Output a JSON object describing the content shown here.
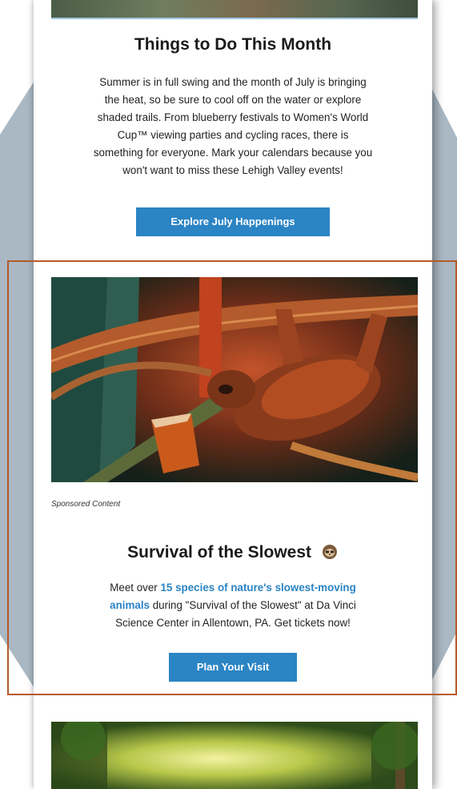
{
  "section1": {
    "title": "Things to Do This Month",
    "body_lines": [
      "Summer is in full swing and the month of July is bringing",
      "the heat, so be sure to cool off on the water or explore",
      "shaded trails. From blueberry festivals to Women's World",
      "Cup™ viewing parties and cycling races, there is",
      "something for everyone. Mark your calendars because you",
      "won't want to miss these Lehigh Valley events!"
    ],
    "cta_label": "Explore July Happenings"
  },
  "section2": {
    "sponsored_label": "Sponsored Content",
    "title": "Survival of the Slowest",
    "title_icon": "sloth-icon",
    "body_prefix": "Meet over ",
    "link_line1": "15 species of nature's slowest-moving",
    "link_line2": "animals",
    "body_line2_rest": " during \"Survival of the Slowest\" at Da Vinci",
    "body_line3": "Science Center in Allentown, PA. Get tickets now!",
    "cta_label": "Plan Your Visit"
  },
  "colors": {
    "accent": "#2b84c4",
    "highlight_border": "#b65a2a",
    "background_shape": "#a9b8c3"
  }
}
